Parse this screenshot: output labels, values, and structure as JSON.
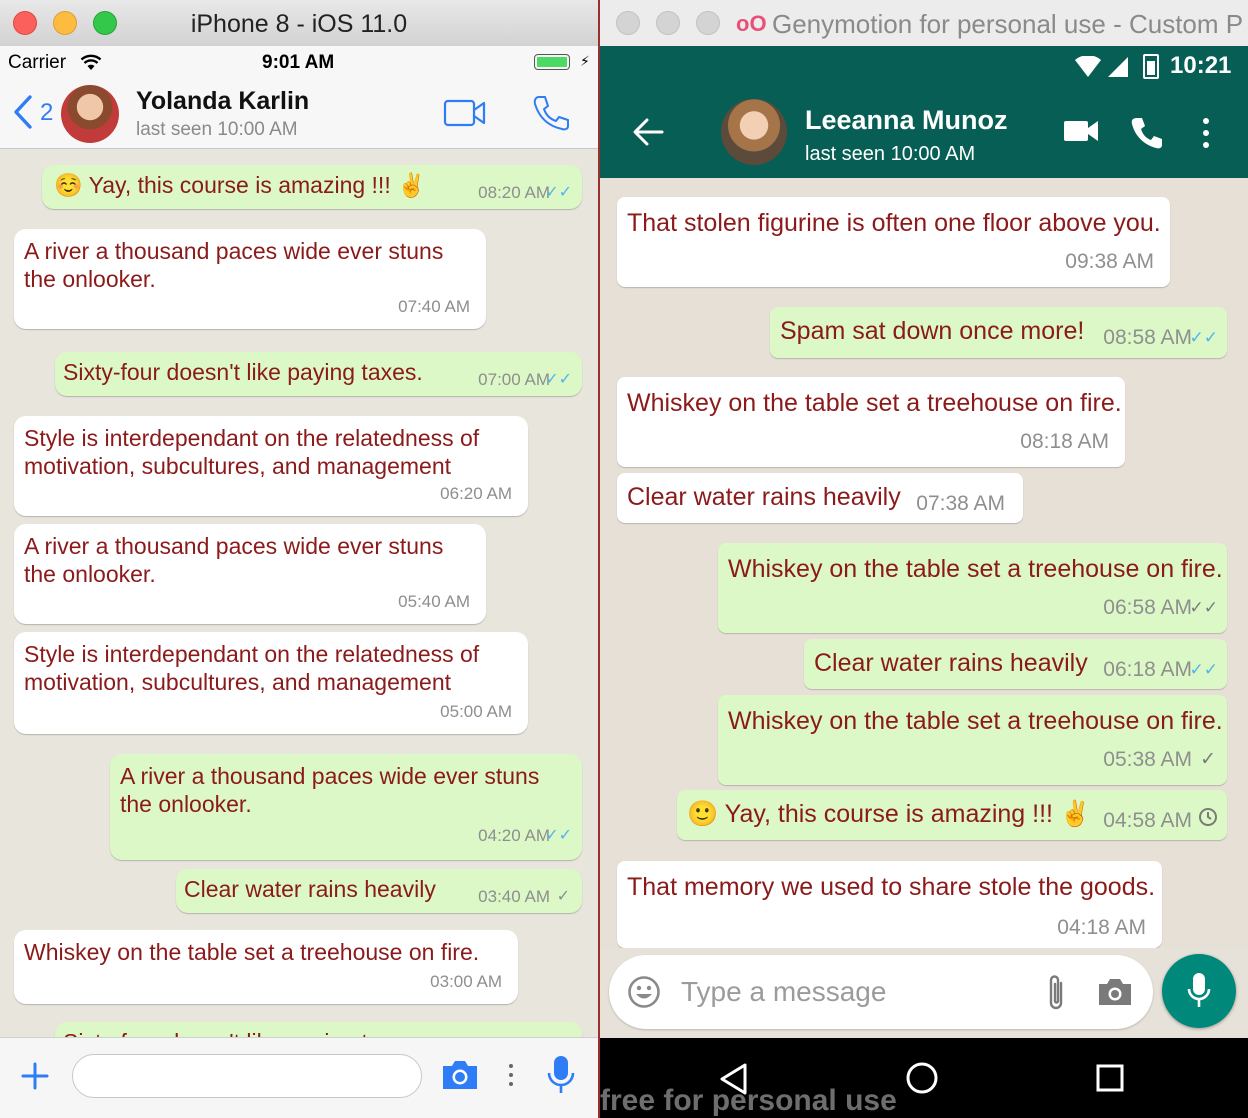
{
  "ios": {
    "window_title": "iPhone 8 - iOS 11.0",
    "status": {
      "carrier": "Carrier",
      "time": "9:01 AM"
    },
    "nav": {
      "back_count": "2",
      "contact_name": "Yolanda Karlin",
      "last_seen": "last seen 10:00 AM"
    },
    "messages": [
      {
        "text": "☺️ Yay, this course is amazing !!! ✌️",
        "time": "08:20 AM",
        "out": true,
        "status": "read"
      },
      {
        "text": "A river a thousand paces wide ever stuns the onlooker.",
        "time": "07:40 AM",
        "out": false
      },
      {
        "text": "Sixty-four doesn't like paying taxes.",
        "time": "07:00 AM",
        "out": true,
        "status": "read"
      },
      {
        "text": "Style is interdependant on the relatedness of motivation, subcultures, and management",
        "time": "06:20 AM",
        "out": false
      },
      {
        "text": "A river a thousand paces wide ever stuns the onlooker.",
        "time": "05:40 AM",
        "out": false
      },
      {
        "text": "Style is interdependant on the relatedness of motivation, subcultures, and management",
        "time": "05:00 AM",
        "out": false
      },
      {
        "text": "A river a thousand paces wide ever stuns the onlooker.",
        "time": "04:20 AM",
        "out": true,
        "status": "read"
      },
      {
        "text": "Clear water rains heavily",
        "time": "03:40 AM",
        "out": true,
        "status": "sent"
      },
      {
        "text": "Whiskey on the table set a treehouse on fire.",
        "time": "03:00 AM",
        "out": false
      },
      {
        "text": "Sixty-four doesn't like paying taxes.",
        "time": "",
        "out": true,
        "status": ""
      }
    ]
  },
  "android": {
    "window_title": "Genymotion for personal use - Custom P",
    "status": {
      "time": "10:21"
    },
    "toolbar": {
      "contact_name": "Leeanna Munoz",
      "last_seen": "last seen 10:00 AM"
    },
    "messages": [
      {
        "text": "That stolen figurine is often one floor above you.",
        "time": "09:38 AM",
        "out": false
      },
      {
        "text": "Spam sat down once more!",
        "time": "08:58 AM",
        "out": true,
        "status": "read"
      },
      {
        "text": "Whiskey on the table set a treehouse on fire.",
        "time": "08:18 AM",
        "out": false
      },
      {
        "text": "Clear water rains heavily",
        "time": "07:38 AM",
        "out": false
      },
      {
        "text": "Whiskey on the table set a treehouse on fire.",
        "time": "06:58 AM",
        "out": true,
        "status": "delivered"
      },
      {
        "text": "Clear water rains heavily",
        "time": "06:18 AM",
        "out": true,
        "status": "read"
      },
      {
        "text": "Whiskey on the table set a treehouse on fire.",
        "time": "05:38 AM",
        "out": true,
        "status": "sent"
      },
      {
        "text": "🙂 Yay, this course is amazing !!! ✌️",
        "time": "04:58 AM",
        "out": true,
        "status": "pending"
      },
      {
        "text": "That memory we used to share stole the goods.",
        "time": "04:18 AM",
        "out": false
      }
    ],
    "input": {
      "placeholder": "Type a message"
    },
    "watermark": "free for personal use"
  },
  "colors": {
    "whatsapp_teal": "#075e54",
    "outgoing_bubble": "#dcf8c6",
    "message_text": "#8b1a1a",
    "ios_blue": "#2e7cf6",
    "read_tick": "#4fb6ec"
  },
  "icons": [
    "wifi-icon",
    "battery-icon",
    "back-chevron-icon",
    "video-call-icon",
    "phone-icon",
    "plus-icon",
    "camera-icon",
    "more-icon",
    "mic-icon",
    "back-arrow-icon",
    "emoji-icon",
    "attach-icon",
    "nav-back-icon",
    "nav-home-icon",
    "nav-recents-icon"
  ]
}
